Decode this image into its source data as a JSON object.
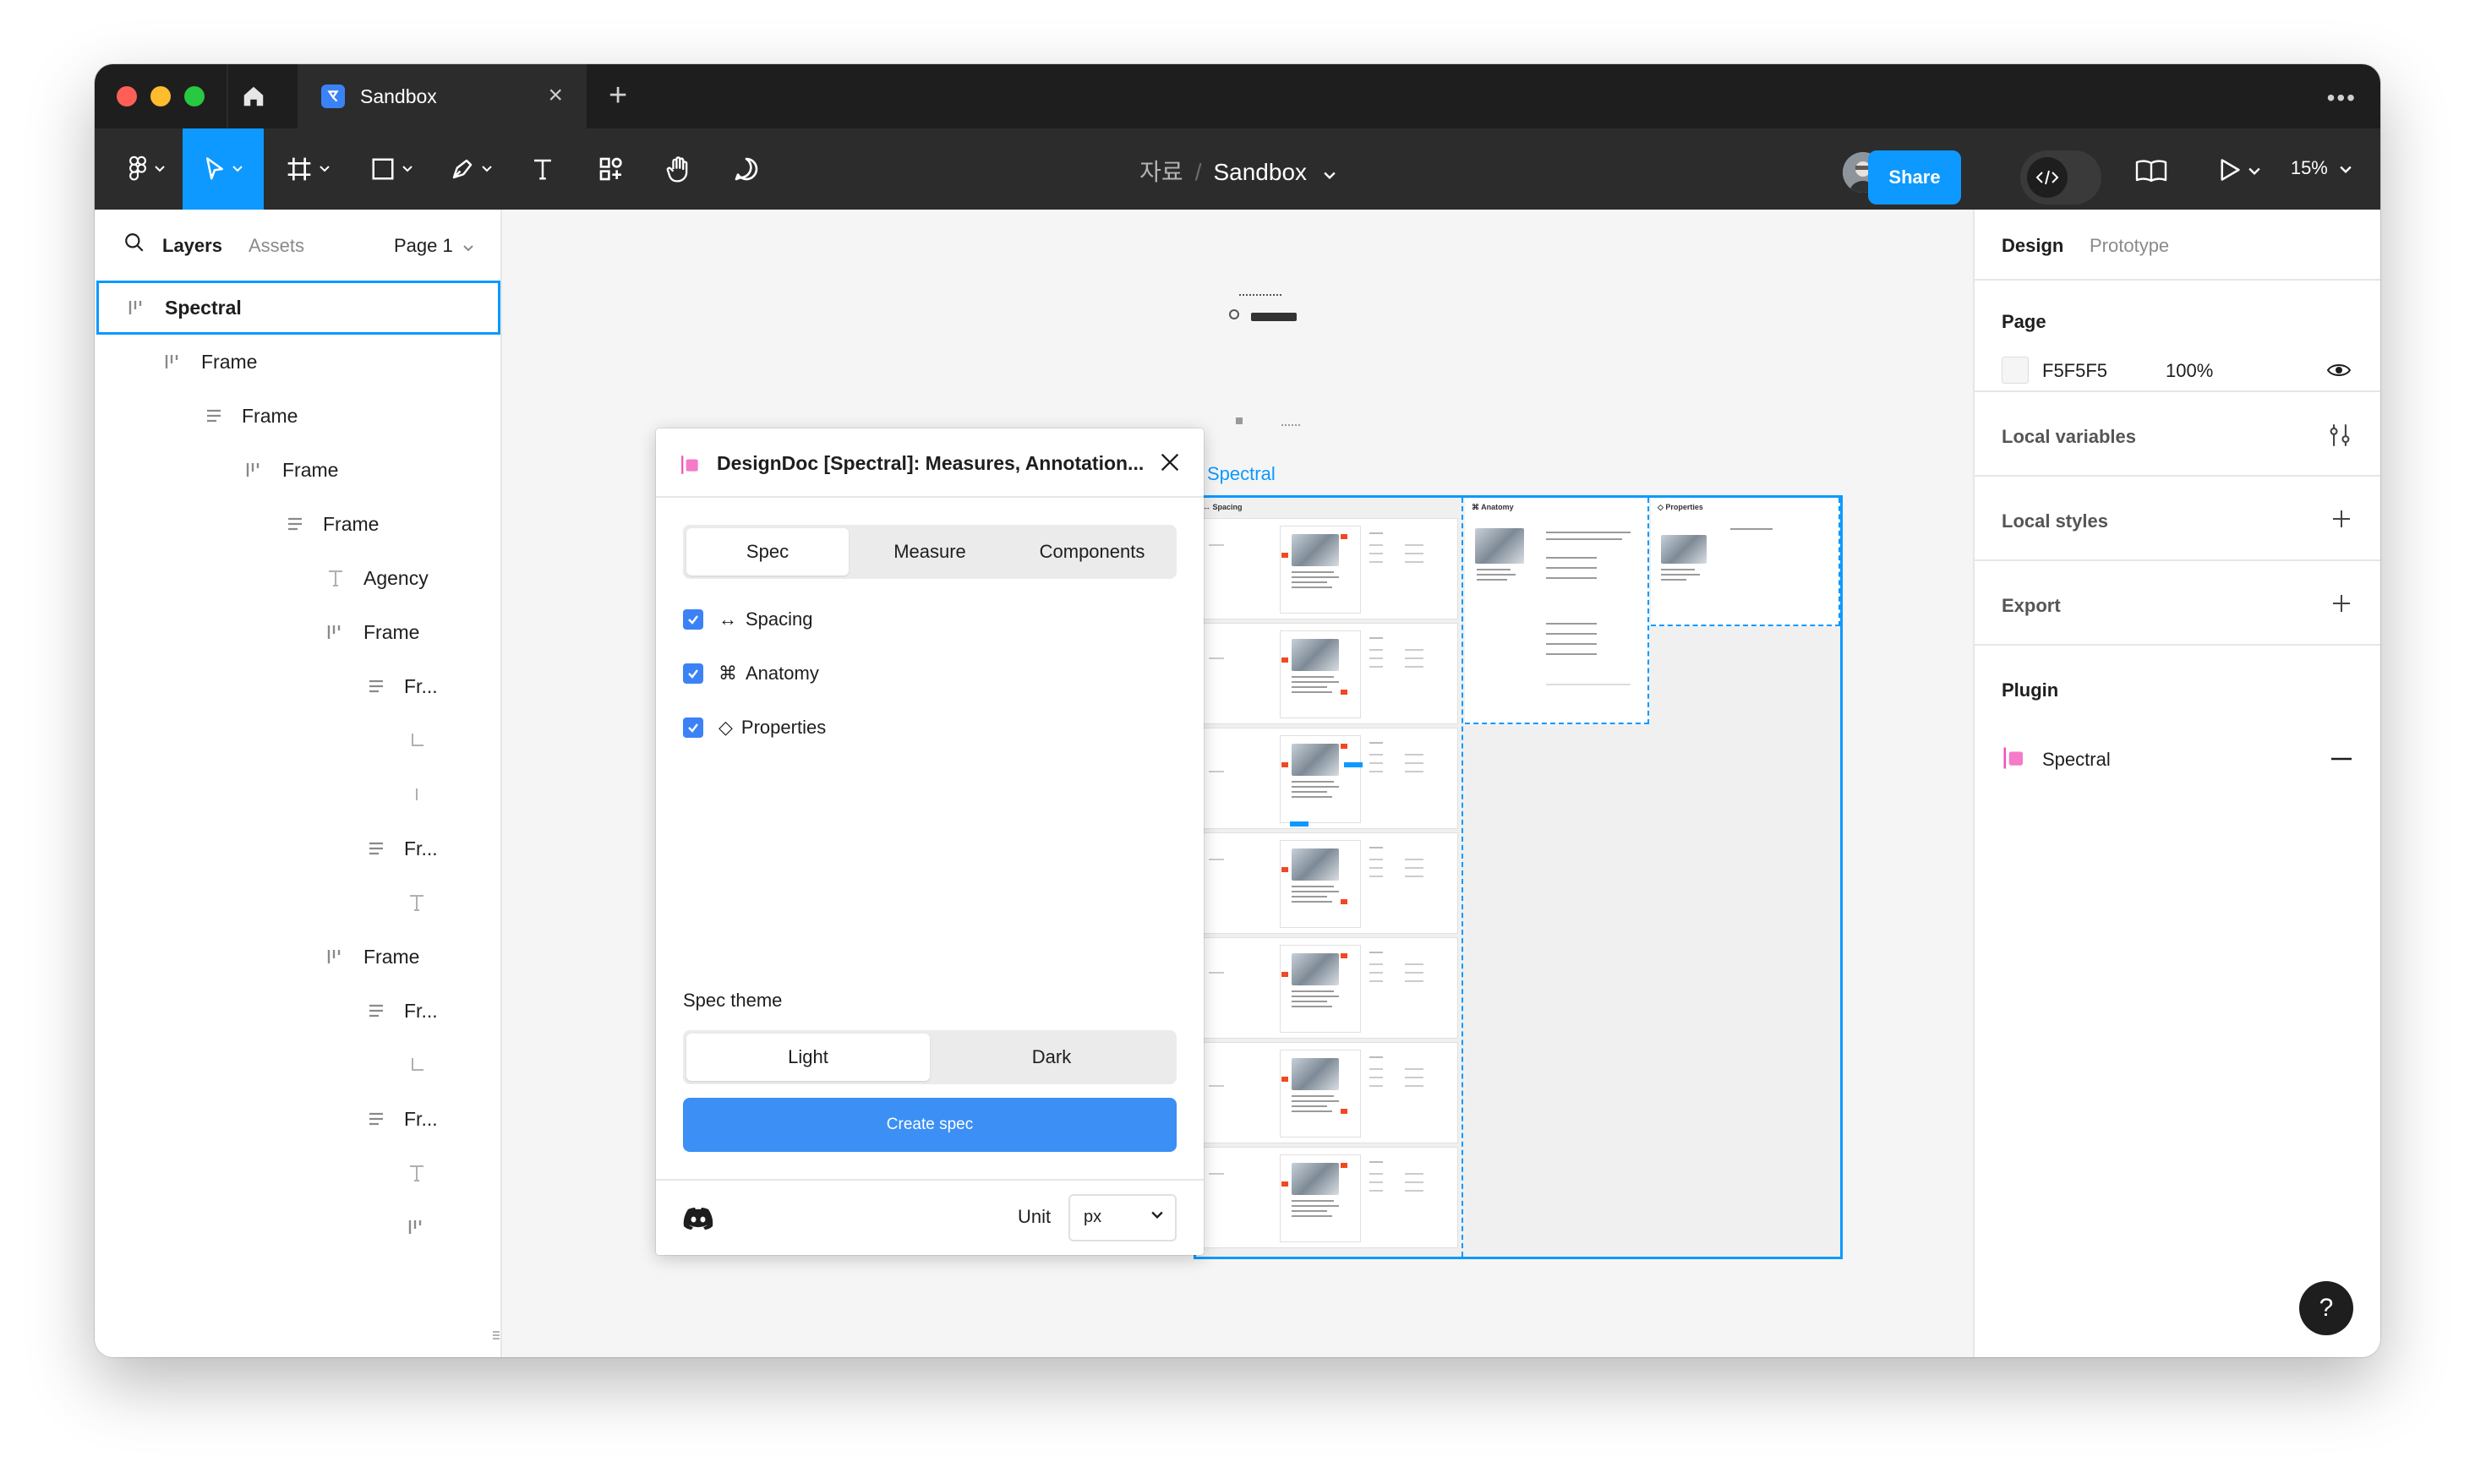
{
  "tabbar": {
    "doc_tab": "Sandbox",
    "close_glyph": "×",
    "new_tab_glyph": "+",
    "more_glyph": "•••"
  },
  "toolbar": {
    "breadcrumb_folder": "자료",
    "breadcrumb_sep": "/",
    "file_name": "Sandbox",
    "share_label": "Share",
    "zoom": "15%",
    "tools": [
      "main-menu",
      "move",
      "frame",
      "shape",
      "pen",
      "text",
      "components",
      "hand",
      "comment"
    ]
  },
  "left_panel": {
    "tabs": {
      "layers": "Layers",
      "assets": "Assets"
    },
    "page_select": "Page 1",
    "layers": [
      {
        "label": "Spectral",
        "icon": "frame-autolayout-icon",
        "depth": 0,
        "selected": true
      },
      {
        "label": "Frame",
        "icon": "frame-autolayout-icon",
        "depth": 1
      },
      {
        "label": "Frame",
        "icon": "stack-vertical-icon",
        "depth": 2
      },
      {
        "label": "Frame",
        "icon": "frame-autolayout-icon",
        "depth": 3
      },
      {
        "label": "Frame",
        "icon": "stack-vertical-icon",
        "depth": 4
      },
      {
        "label": "Agency",
        "icon": "text-icon",
        "depth": 5
      },
      {
        "label": "Frame",
        "icon": "frame-autolayout-icon",
        "depth": 5
      },
      {
        "label": "Fr...",
        "icon": "stack-vertical-icon",
        "depth": 6
      },
      {
        "label": "",
        "icon": "corner-icon",
        "depth": 7
      },
      {
        "label": "",
        "icon": "line-icon",
        "depth": 7
      },
      {
        "label": "Fr...",
        "icon": "stack-vertical-icon",
        "depth": 6
      },
      {
        "label": "",
        "icon": "text-icon",
        "depth": 7
      },
      {
        "label": "Frame",
        "icon": "frame-autolayout-icon",
        "depth": 5
      },
      {
        "label": "Fr...",
        "icon": "stack-vertical-icon",
        "depth": 6
      },
      {
        "label": "",
        "icon": "corner-icon",
        "depth": 7
      },
      {
        "label": "Fr...",
        "icon": "stack-vertical-icon",
        "depth": 6
      },
      {
        "label": "",
        "icon": "text-icon",
        "depth": 7
      },
      {
        "label": "",
        "icon": "frame-autolayout-icon",
        "depth": 7
      }
    ]
  },
  "right_panel": {
    "tabs": {
      "design": "Design",
      "prototype": "Prototype"
    },
    "page": {
      "title": "Page",
      "color_hex": "F5F5F5",
      "opacity": "100%"
    },
    "local_variables": "Local variables",
    "local_styles": "Local styles",
    "export": "Export",
    "plugin": {
      "title": "Plugin",
      "name": "Spectral"
    }
  },
  "canvas": {
    "frame_label": "Spectral",
    "columns": [
      "↔ Spacing",
      "⌘ Anatomy",
      "◇ Properties"
    ],
    "background": "#F5F5F5",
    "selection_color": "#0D99FF"
  },
  "plugin_dialog": {
    "title": "DesignDoc [Spectral]: Measures, Annotation...",
    "tabs": [
      "Spec",
      "Measure",
      "Components"
    ],
    "active_tab": "Spec",
    "options": [
      {
        "glyph": "↔",
        "label": "Spacing",
        "checked": true
      },
      {
        "glyph": "⌘",
        "label": "Anatomy",
        "checked": true
      },
      {
        "glyph": "◇",
        "label": "Properties",
        "checked": true
      }
    ],
    "spec_theme_label": "Spec theme",
    "theme_options": [
      "Light",
      "Dark"
    ],
    "active_theme": "Light",
    "create_button": "Create spec",
    "unit_label": "Unit",
    "unit_value": "px"
  },
  "help_glyph": "?"
}
